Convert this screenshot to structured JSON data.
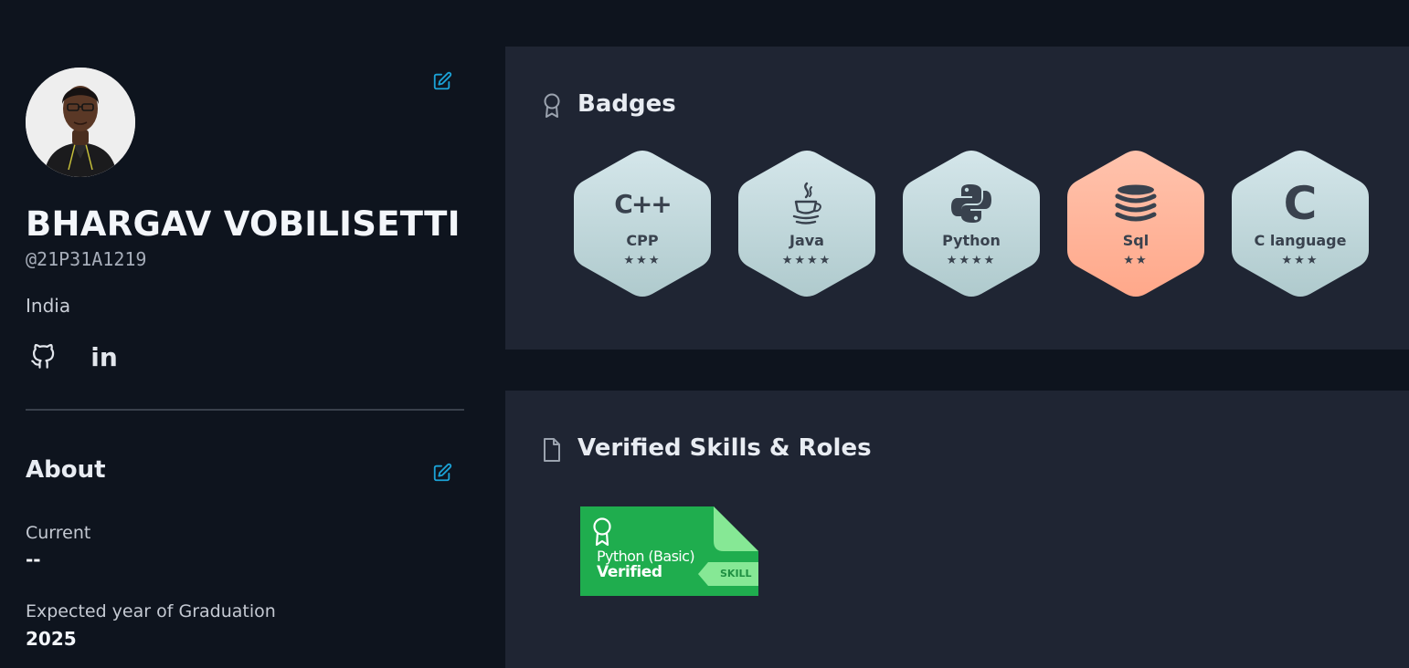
{
  "profile": {
    "name": "BHARGAV VOBILISETTI",
    "handle": "@21P31A1219",
    "country": "India",
    "avatar_icon": "user-avatar-photo",
    "edit_icon": "edit-icon",
    "socials": [
      {
        "name": "GitHub",
        "icon": "github-icon"
      },
      {
        "name": "LinkedIn",
        "icon": "linkedin-icon",
        "glyph": "in"
      }
    ]
  },
  "about": {
    "title": "About",
    "current_label": "Current",
    "current_value": "--",
    "graduation_label": "Expected year of Graduation",
    "graduation_value": "2025"
  },
  "badges": {
    "title": "Badges",
    "icon": "ribbon-icon",
    "items": [
      {
        "name": "CPP",
        "stars": 3,
        "icon": "cpp-icon",
        "glyph": "C++",
        "color": "#c5dde0"
      },
      {
        "name": "Java",
        "stars": 4,
        "icon": "java-cup-icon",
        "color": "#c5dde0"
      },
      {
        "name": "Python",
        "stars": 4,
        "icon": "python-icon",
        "color": "#c5dde0"
      },
      {
        "name": "Sql",
        "stars": 2,
        "icon": "database-icon",
        "color": "#ffb399"
      },
      {
        "name": "C language",
        "stars": 3,
        "icon": "c-language-icon",
        "glyph": "C",
        "color": "#c5dde0"
      }
    ]
  },
  "skills": {
    "title": "Verified Skills & Roles",
    "icon": "document-icon",
    "items": [
      {
        "name": "Python (Basic)",
        "status": "Verified",
        "tag": "SKILL",
        "icon": "certificate-ribbon-icon",
        "color": "#1fad4e"
      }
    ]
  },
  "colors": {
    "background": "#0e141e",
    "card": "#1f2533",
    "accent": "#1ba2d6",
    "badge_default": "#c5dde0",
    "badge_sql": "#ffb399",
    "cert_green": "#1fad4e"
  }
}
